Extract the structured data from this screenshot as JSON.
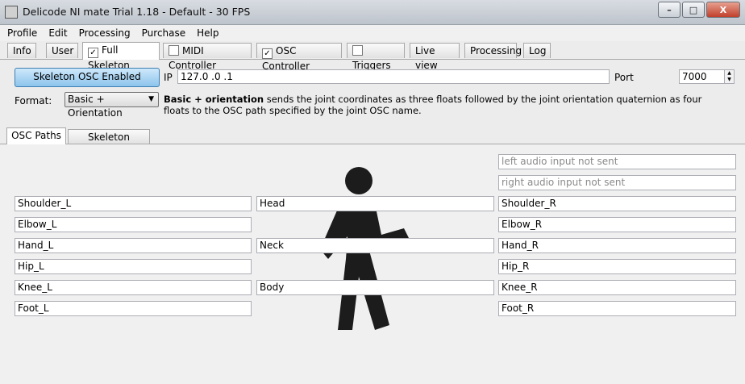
{
  "window": {
    "title": "Delicode NI mate Trial 1.18 - Default - 30 FPS",
    "controls": [
      "–",
      "□",
      "X"
    ]
  },
  "menu": [
    "Profile",
    "Edit",
    "Processing",
    "Purchase",
    "Help"
  ],
  "tabs": [
    {
      "label": "Info",
      "checkbox": false
    },
    {
      "label": "User",
      "checkbox": false
    },
    {
      "label": "Full Skeleton",
      "checkbox": true,
      "checked": true
    },
    {
      "label": "MIDI Controller",
      "checkbox": true,
      "checked": false
    },
    {
      "label": "OSC Controller",
      "checkbox": true,
      "checked": true
    },
    {
      "label": "Triggers",
      "checkbox": true,
      "checked": false
    },
    {
      "label": "Live view",
      "checkbox": false
    },
    {
      "label": "Processing",
      "checkbox": false
    },
    {
      "label": "Log",
      "checkbox": false
    }
  ],
  "osc": {
    "button_label": "Skeleton OSC Enabled",
    "ip_label": "IP",
    "ip_value": "127.0 .0 .1",
    "port_label": "Port",
    "port_value": "7000"
  },
  "format": {
    "label": "Format:",
    "selected": "Basic + Orientation",
    "desc_bold": "Basic + orientation",
    "desc_text": " sends the joint coordinates as three floats followed by the joint orientation quaternion as four floats to the OSC path specified by the joint OSC name."
  },
  "subtabs": [
    "OSC Paths",
    "Skeleton Settings"
  ],
  "paths": {
    "left_audio": "left audio input not sent",
    "right_audio": "right audio input not sent",
    "shoulder_l": "Shoulder_L",
    "head": "Head",
    "shoulder_r": "Shoulder_R",
    "elbow_l": "Elbow_L",
    "elbow_r": "Elbow_R",
    "hand_l": "Hand_L",
    "neck": "Neck",
    "hand_r": "Hand_R",
    "hip_l": "Hip_L",
    "hip_r": "Hip_R",
    "knee_l": "Knee_L",
    "body": "Body",
    "knee_r": "Knee_R",
    "foot_l": "Foot_L",
    "foot_r": "Foot_R"
  },
  "colors": {
    "button_blue": "#8cc4ec",
    "figure": "#1c1c1c"
  },
  "icons": {
    "app": "app-icon",
    "figure": "walking-person-icon"
  }
}
